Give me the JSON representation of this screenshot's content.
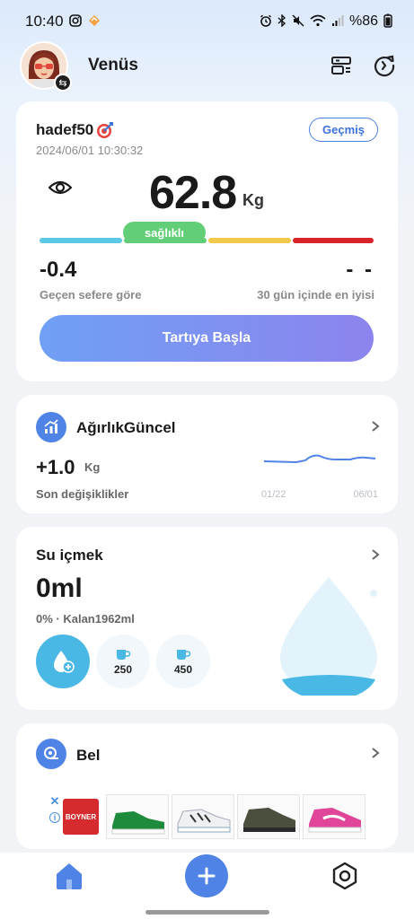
{
  "status_bar": {
    "time": "10:40",
    "battery": "%86"
  },
  "header": {
    "username": "Venüs",
    "icons": [
      "device-list-icon",
      "refresh-icon"
    ]
  },
  "weight_card": {
    "goal_label": "hadef50",
    "history_button": "Geçmiş",
    "timestamp": "2024/06/01 10:30:32",
    "weight_value": "62.8",
    "weight_unit": "Kg",
    "status_badge": "sağlıklı",
    "delta_value": "-0.4",
    "delta_label": "Geçen sefere göre",
    "best_value": "- -",
    "best_label": "30 gün içinde en iyisi",
    "start_button": "Tartıya Başla",
    "scale_colors": [
      "#5cc8e6",
      "#62cf78",
      "#f2c94c",
      "#d9232a"
    ]
  },
  "trend_card": {
    "title": "AğırlıkGüncel",
    "value": "+1.0",
    "unit": "Kg",
    "label": "Son değişiklikler",
    "chart_start": "01/22",
    "chart_end": "06/01"
  },
  "water_card": {
    "title": "Su içmek",
    "value": "0ml",
    "subtitle": "0% · Kalan1962ml",
    "cup_small": "250",
    "cup_large": "450",
    "progress": 0
  },
  "waist_card": {
    "title": "Bel"
  },
  "ad": {
    "brand": "BOYNER"
  },
  "colors": {
    "accent": "#4f84e6",
    "water": "#4ab8e5",
    "healthy": "#62cf78"
  }
}
